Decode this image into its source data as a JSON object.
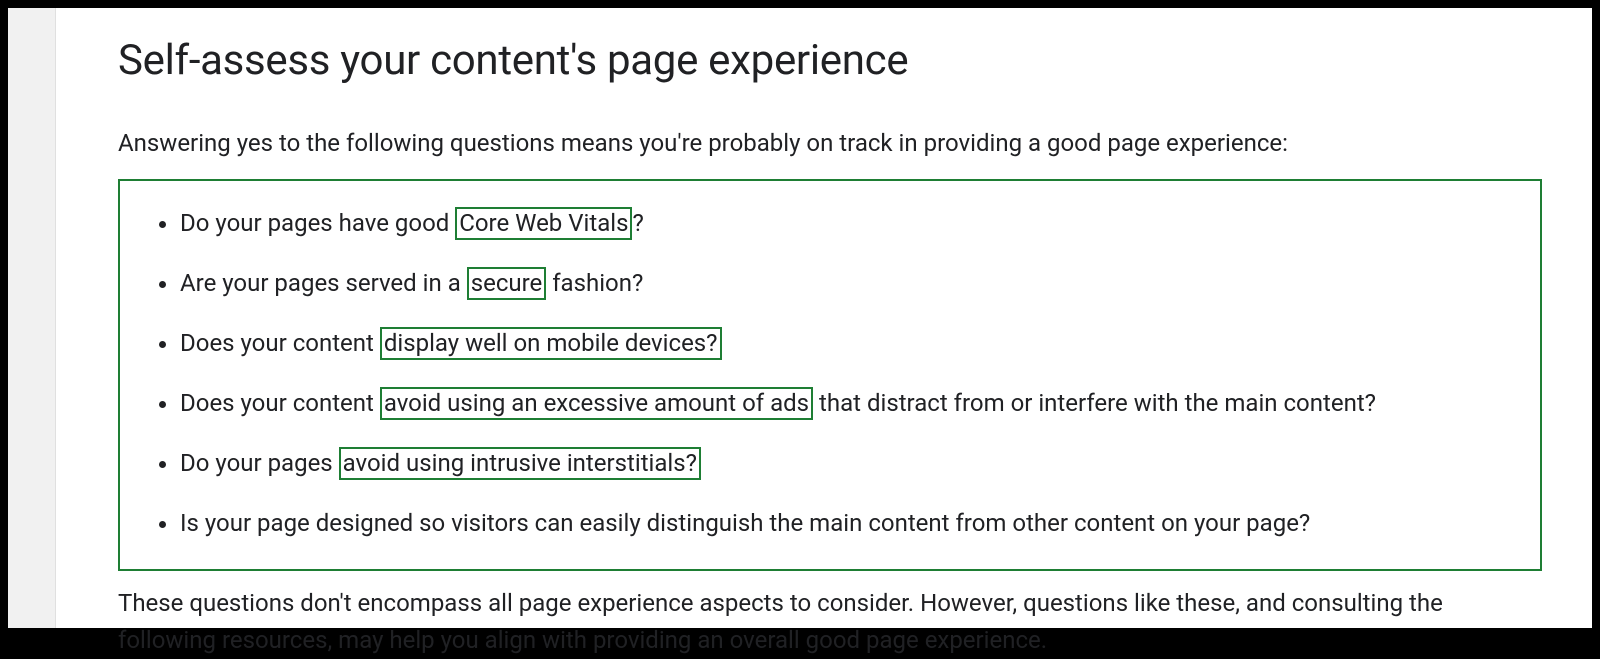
{
  "heading": "Self-assess your content's page experience",
  "intro": "Answering yes to the following questions means you're probably on track in providing a good page experience:",
  "questions": [
    {
      "pre": "Do your pages have good ",
      "highlight": "Core Web Vitals",
      "post": "?"
    },
    {
      "pre": "Are your pages served in a ",
      "highlight": "secure",
      "post": " fashion?"
    },
    {
      "pre": "Does your content ",
      "highlight": "display well on mobile devices?",
      "post": ""
    },
    {
      "pre": "Does your content ",
      "highlight": "avoid using an excessive amount of ads",
      "post": " that distract from or interfere with the main content?"
    },
    {
      "pre": "Do your pages ",
      "highlight": "avoid using intrusive interstitials?",
      "post": ""
    },
    {
      "pre": "Is your page designed so visitors can easily distinguish the main content from other content on your page?",
      "highlight": "",
      "post": ""
    }
  ],
  "outro": "These questions don't encompass all page experience aspects to consider. However, questions like these, and consulting the following resources, may help you align with providing an overall good page experience."
}
